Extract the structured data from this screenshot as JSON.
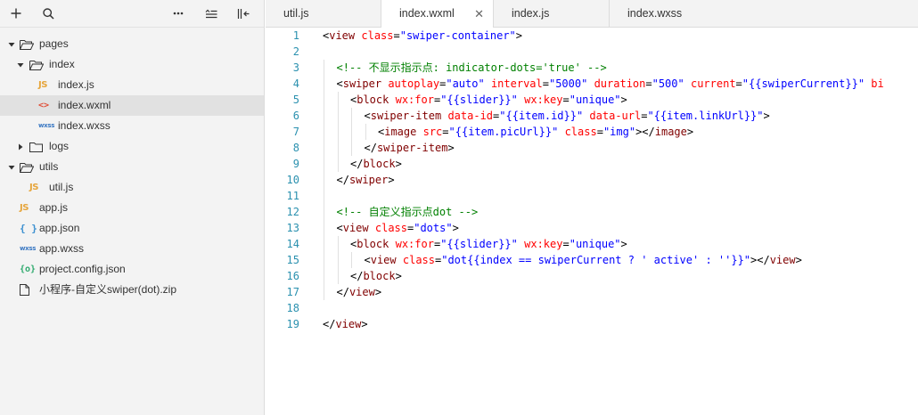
{
  "toolbar": {
    "buttons": [
      {
        "name": "add-icon"
      },
      {
        "name": "search-icon"
      },
      {
        "name": "more-icon"
      },
      {
        "name": "collapse-all-icon"
      },
      {
        "name": "toggle-sidebar-icon"
      }
    ]
  },
  "tree": [
    {
      "label": "pages",
      "type": "folder",
      "expanded": true,
      "depth": 0
    },
    {
      "label": "index",
      "type": "folder",
      "expanded": true,
      "depth": 1
    },
    {
      "label": "index.js",
      "type": "js",
      "icon_text": "JS",
      "depth": 2
    },
    {
      "label": "index.wxml",
      "type": "wxml",
      "icon_text": "<>",
      "depth": 2,
      "selected": true
    },
    {
      "label": "index.wxss",
      "type": "wxss",
      "icon_text": "wxss",
      "depth": 2
    },
    {
      "label": "logs",
      "type": "folder",
      "expanded": false,
      "depth": 1
    },
    {
      "label": "utils",
      "type": "folder",
      "expanded": true,
      "depth": 0
    },
    {
      "label": "util.js",
      "type": "js",
      "icon_text": "JS",
      "depth": 1
    },
    {
      "label": "app.js",
      "type": "js",
      "icon_text": "JS",
      "depth": 0
    },
    {
      "label": "app.json",
      "type": "json",
      "icon_text": "{ }",
      "depth": 0
    },
    {
      "label": "app.wxss",
      "type": "wxss",
      "icon_text": "wxss",
      "depth": 0
    },
    {
      "label": "project.config.json",
      "type": "cfg",
      "icon_text": "{o}",
      "depth": 0
    },
    {
      "label": "小程序-自定义swiper(dot).zip",
      "type": "file",
      "depth": 0
    }
  ],
  "tabs": [
    {
      "label": "util.js",
      "active": false
    },
    {
      "label": "index.wxml",
      "active": true,
      "close": "✕"
    },
    {
      "label": "index.js",
      "active": false
    },
    {
      "label": "index.wxss",
      "active": false
    }
  ],
  "editor": {
    "lines": [
      {
        "n": "1",
        "indent": 0,
        "tokens": [
          [
            "p",
            "<"
          ],
          [
            "t",
            "view"
          ],
          [
            "p",
            " "
          ],
          [
            "a",
            "class"
          ],
          [
            "p",
            "="
          ],
          [
            "s",
            "\"swiper-container\""
          ],
          [
            "p",
            ">"
          ]
        ]
      },
      {
        "n": "2",
        "indent": 0,
        "tokens": []
      },
      {
        "n": "3",
        "indent": 1,
        "tokens": [
          [
            "c",
            "<!-- 不显示指示点: indicator-dots='true' -->"
          ]
        ]
      },
      {
        "n": "4",
        "indent": 1,
        "tokens": [
          [
            "p",
            "<"
          ],
          [
            "t",
            "swiper"
          ],
          [
            "p",
            " "
          ],
          [
            "a",
            "autoplay"
          ],
          [
            "p",
            "="
          ],
          [
            "s",
            "\"auto\""
          ],
          [
            "p",
            " "
          ],
          [
            "a",
            "interval"
          ],
          [
            "p",
            "="
          ],
          [
            "s",
            "\"5000\""
          ],
          [
            "p",
            " "
          ],
          [
            "a",
            "duration"
          ],
          [
            "p",
            "="
          ],
          [
            "s",
            "\"500\""
          ],
          [
            "p",
            " "
          ],
          [
            "a",
            "current"
          ],
          [
            "p",
            "="
          ],
          [
            "s",
            "\"{{swiperCurrent}}\""
          ],
          [
            "p",
            " "
          ],
          [
            "a",
            "bi"
          ]
        ]
      },
      {
        "n": "5",
        "indent": 2,
        "tokens": [
          [
            "p",
            "<"
          ],
          [
            "t",
            "block"
          ],
          [
            "p",
            " "
          ],
          [
            "a",
            "wx:for"
          ],
          [
            "p",
            "="
          ],
          [
            "s",
            "\"{{slider}}\""
          ],
          [
            "p",
            " "
          ],
          [
            "a",
            "wx:key"
          ],
          [
            "p",
            "="
          ],
          [
            "s",
            "\"unique\""
          ],
          [
            "p",
            ">"
          ]
        ]
      },
      {
        "n": "6",
        "indent": 3,
        "tokens": [
          [
            "p",
            "<"
          ],
          [
            "t",
            "swiper-item"
          ],
          [
            "p",
            " "
          ],
          [
            "a",
            "data-id"
          ],
          [
            "p",
            "="
          ],
          [
            "s",
            "\"{{item.id}}\""
          ],
          [
            "p",
            " "
          ],
          [
            "a",
            "data-url"
          ],
          [
            "p",
            "="
          ],
          [
            "s",
            "\"{{item.linkUrl}}\""
          ],
          [
            "p",
            ">"
          ]
        ]
      },
      {
        "n": "7",
        "indent": 4,
        "tokens": [
          [
            "p",
            "<"
          ],
          [
            "t",
            "image"
          ],
          [
            "p",
            " "
          ],
          [
            "a",
            "src"
          ],
          [
            "p",
            "="
          ],
          [
            "s",
            "\"{{item.picUrl}}\""
          ],
          [
            "p",
            " "
          ],
          [
            "a",
            "class"
          ],
          [
            "p",
            "="
          ],
          [
            "s",
            "\"img\""
          ],
          [
            "p",
            "></"
          ],
          [
            "t",
            "image"
          ],
          [
            "p",
            ">"
          ]
        ]
      },
      {
        "n": "8",
        "indent": 3,
        "tokens": [
          [
            "p",
            "</"
          ],
          [
            "t",
            "swiper-item"
          ],
          [
            "p",
            ">"
          ]
        ]
      },
      {
        "n": "9",
        "indent": 2,
        "tokens": [
          [
            "p",
            "</"
          ],
          [
            "t",
            "block"
          ],
          [
            "p",
            ">"
          ]
        ]
      },
      {
        "n": "10",
        "indent": 1,
        "tokens": [
          [
            "p",
            "</"
          ],
          [
            "t",
            "swiper"
          ],
          [
            "p",
            ">"
          ]
        ]
      },
      {
        "n": "11",
        "indent": 0,
        "tokens": []
      },
      {
        "n": "12",
        "indent": 1,
        "tokens": [
          [
            "c",
            "<!-- 自定义指示点dot -->"
          ]
        ]
      },
      {
        "n": "13",
        "indent": 1,
        "tokens": [
          [
            "p",
            "<"
          ],
          [
            "t",
            "view"
          ],
          [
            "p",
            " "
          ],
          [
            "a",
            "class"
          ],
          [
            "p",
            "="
          ],
          [
            "s",
            "\"dots\""
          ],
          [
            "p",
            ">"
          ]
        ]
      },
      {
        "n": "14",
        "indent": 2,
        "tokens": [
          [
            "p",
            "<"
          ],
          [
            "t",
            "block"
          ],
          [
            "p",
            " "
          ],
          [
            "a",
            "wx:for"
          ],
          [
            "p",
            "="
          ],
          [
            "s",
            "\"{{slider}}\""
          ],
          [
            "p",
            " "
          ],
          [
            "a",
            "wx:key"
          ],
          [
            "p",
            "="
          ],
          [
            "s",
            "\"unique\""
          ],
          [
            "p",
            ">"
          ]
        ]
      },
      {
        "n": "15",
        "indent": 3,
        "tokens": [
          [
            "p",
            "<"
          ],
          [
            "t",
            "view"
          ],
          [
            "p",
            " "
          ],
          [
            "a",
            "class"
          ],
          [
            "p",
            "="
          ],
          [
            "s",
            "\"dot{{index == swiperCurrent ? ' active' : ''}}\""
          ],
          [
            "p",
            "></"
          ],
          [
            "t",
            "view"
          ],
          [
            "p",
            ">"
          ]
        ]
      },
      {
        "n": "16",
        "indent": 2,
        "tokens": [
          [
            "p",
            "</"
          ],
          [
            "t",
            "block"
          ],
          [
            "p",
            ">"
          ]
        ]
      },
      {
        "n": "17",
        "indent": 1,
        "tokens": [
          [
            "p",
            "</"
          ],
          [
            "t",
            "view"
          ],
          [
            "p",
            ">"
          ]
        ]
      },
      {
        "n": "18",
        "indent": 0,
        "tokens": []
      },
      {
        "n": "19",
        "indent": 0,
        "tokens": [
          [
            "p",
            "</"
          ],
          [
            "t",
            "view"
          ],
          [
            "p",
            ">"
          ]
        ]
      }
    ]
  },
  "colors": {
    "tag": "#800000",
    "attribute": "#ff0000",
    "string": "#0000ff",
    "comment": "#008000",
    "line_number": "#2b91af",
    "selected_row": "#e1e1e1"
  }
}
